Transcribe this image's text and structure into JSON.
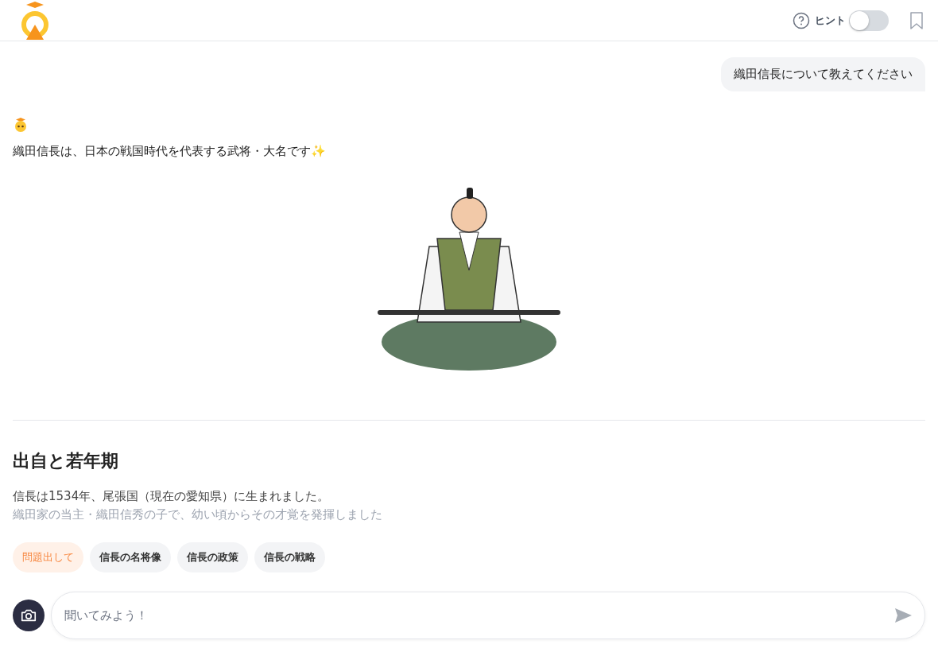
{
  "header": {
    "hint_label": "ヒント",
    "hint_toggle": {
      "on": false
    }
  },
  "user_message": "織田信長について教えてください",
  "answer": {
    "intro": "織田信長は、日本の戦国時代を代表する武将・大名です✨",
    "heading": "出自と若年期",
    "paragraph": "信長は1534年、尾張国（現在の愛知県）に生まれました。",
    "faded_line": "織田家の当主・織田信秀の子で、幼い頃からその才覚を発揮しました"
  },
  "suggestions": [
    {
      "label": "問題出して",
      "kind": "quiz"
    },
    {
      "label": "信長の名将像",
      "kind": "topic"
    },
    {
      "label": "信長の政策",
      "kind": "topic"
    },
    {
      "label": "信長の戦略",
      "kind": "topic"
    }
  ],
  "composer": {
    "placeholder": "聞いてみよう！"
  }
}
